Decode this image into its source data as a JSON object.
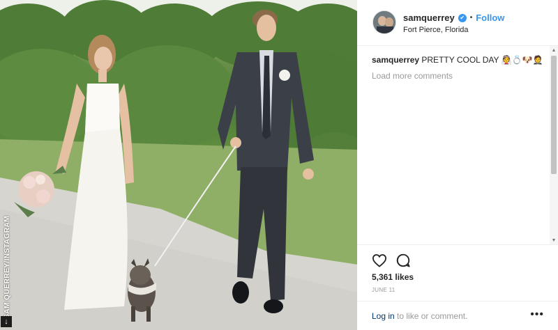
{
  "photo": {
    "watermark": "SAM QUERREY/INSTAGRAM",
    "logo_glyph": "↓"
  },
  "header": {
    "username": "samquerrey",
    "verified_icon": "✔",
    "separator": "•",
    "follow_label": "Follow",
    "location": "Fort Pierce, Florida"
  },
  "comment": {
    "username": "samquerrey",
    "text": "PRETTY COOL DAY 👰💍🐶🤵"
  },
  "load_more_label": "Load more comments",
  "likes_label": "5,361 likes",
  "date_label": "JUNE 11",
  "login": {
    "link_label": "Log in",
    "suffix": "to like or comment."
  },
  "more_dots": "•••",
  "scroll": {
    "up": "▲",
    "down": "▼"
  },
  "colors": {
    "accent": "#3897f0",
    "muted": "#999999",
    "text": "#262626"
  }
}
